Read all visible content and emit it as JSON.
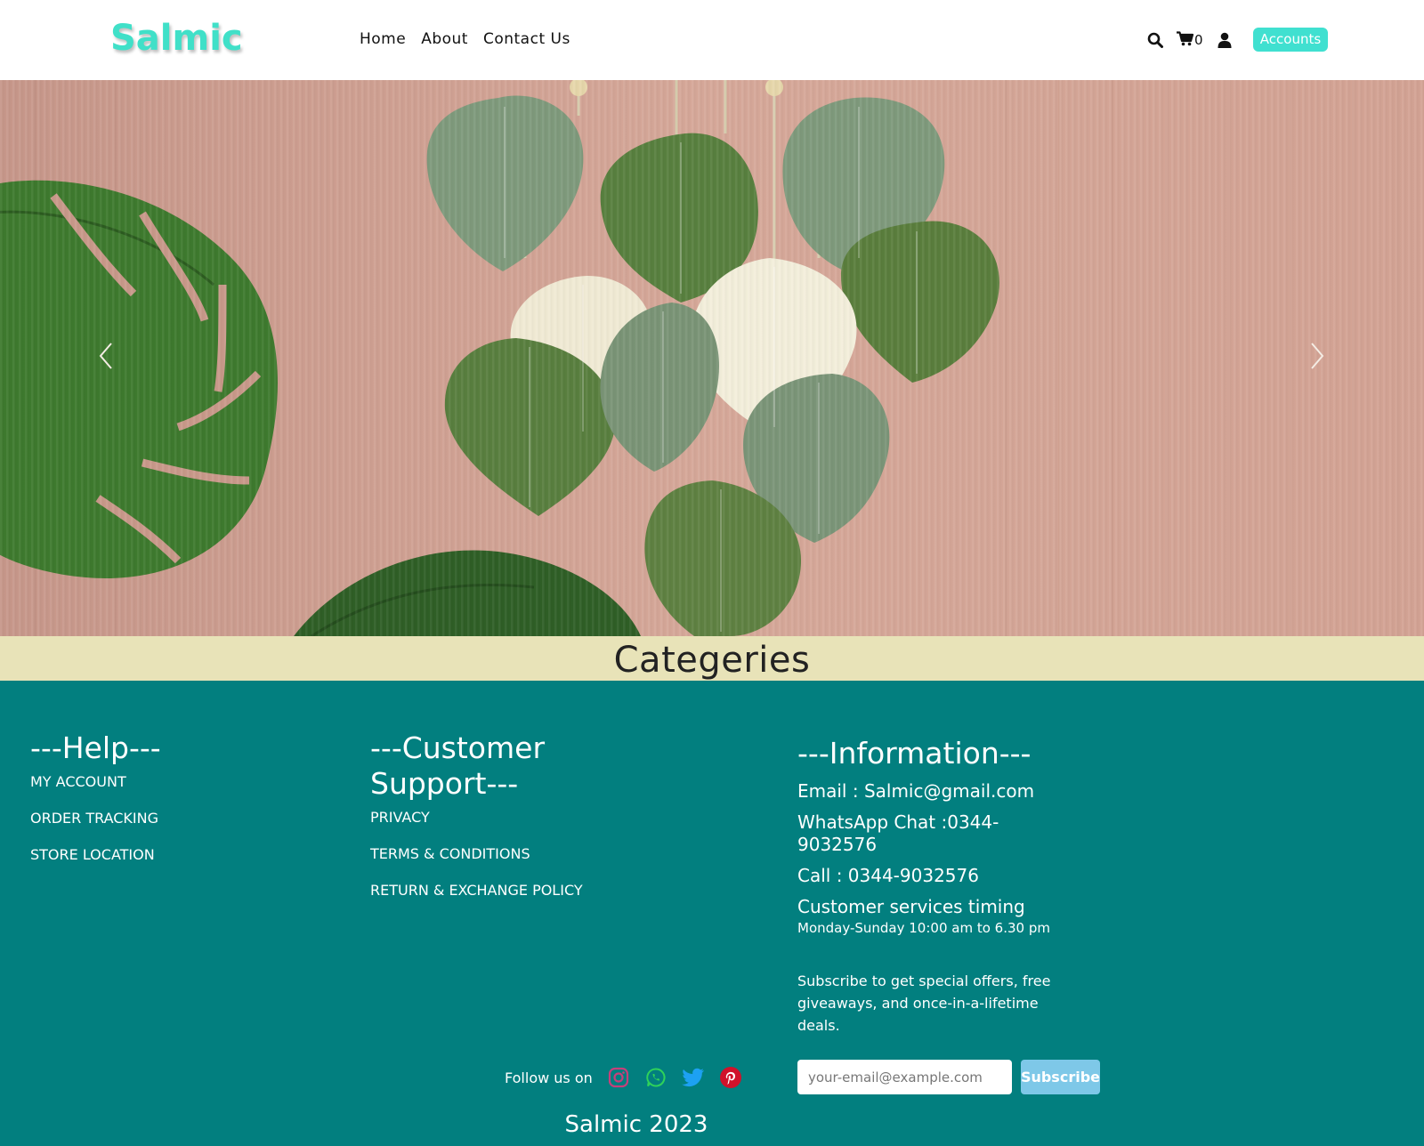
{
  "header": {
    "logo": "Salmic",
    "nav": [
      "Home",
      "About",
      "Contact Us"
    ],
    "cart_count": "0",
    "accounts_label": "Accounts"
  },
  "hero": {
    "image_alt": "macrame leaf wall hanging with monstera leaves",
    "prev_icon": "chevron-left-icon",
    "next_icon": "chevron-right-icon"
  },
  "categories": {
    "title": "Categeries"
  },
  "footer": {
    "help": {
      "title": "---Help---",
      "links": [
        "MY ACCOUNT",
        "ORDER TRACKING",
        "STORE LOCATION"
      ]
    },
    "support": {
      "title": "---Customer Support---",
      "links": [
        "PRIVACY",
        "TERMS & CONDITIONS",
        "RETURN & EXCHANGE POLICY"
      ]
    },
    "information": {
      "title": "---Information---",
      "email": "Email : Salmic@gmail.com",
      "whatsapp": "WhatsApp Chat :0344-9032576",
      "call": "Call : 0344-9032576",
      "timing_title": "Customer services timing",
      "timing": "Monday-Sunday 10:00 am to 6.30 pm"
    },
    "subscribe": {
      "text": "Subscribe to get special offers, free giveaways, and once-in-a-lifetime deals.",
      "placeholder": "your-email@example.com",
      "button": "Subscribe"
    },
    "follow_label": "Follow us on",
    "social": [
      "instagram-icon",
      "whatsapp-icon",
      "twitter-icon",
      "pinterest-icon"
    ],
    "copyright": "Salmic 2023"
  },
  "colors": {
    "accent": "#40e0d0",
    "footer_bg": "#027f7f",
    "category_band": "#e8e3b8"
  }
}
